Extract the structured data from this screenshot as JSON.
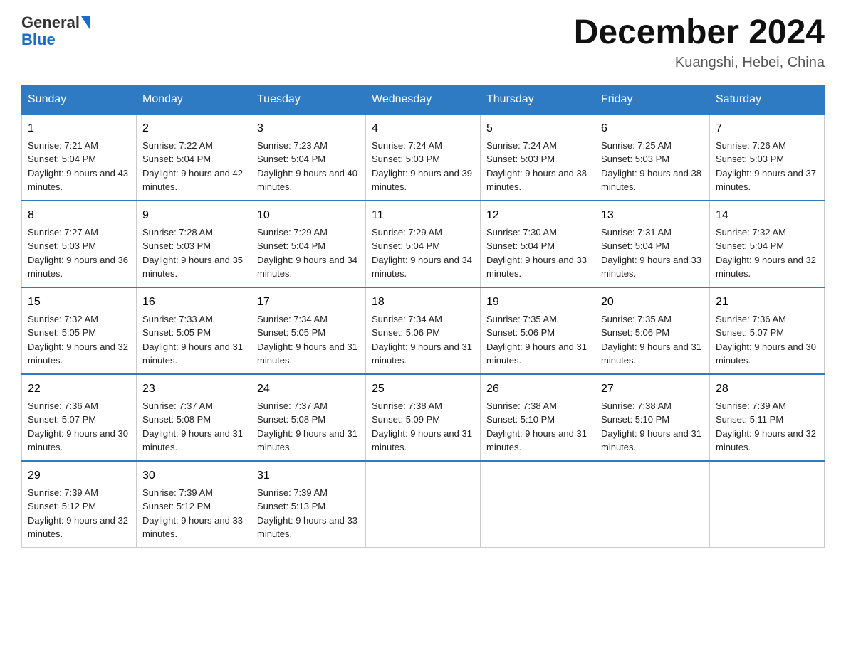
{
  "logo": {
    "text1": "General",
    "text2": "Blue"
  },
  "title": "December 2024",
  "location": "Kuangshi, Hebei, China",
  "days_of_week": [
    "Sunday",
    "Monday",
    "Tuesday",
    "Wednesday",
    "Thursday",
    "Friday",
    "Saturday"
  ],
  "weeks": [
    [
      {
        "day": "1",
        "sunrise": "7:21 AM",
        "sunset": "5:04 PM",
        "daylight": "9 hours and 43 minutes."
      },
      {
        "day": "2",
        "sunrise": "7:22 AM",
        "sunset": "5:04 PM",
        "daylight": "9 hours and 42 minutes."
      },
      {
        "day": "3",
        "sunrise": "7:23 AM",
        "sunset": "5:04 PM",
        "daylight": "9 hours and 40 minutes."
      },
      {
        "day": "4",
        "sunrise": "7:24 AM",
        "sunset": "5:03 PM",
        "daylight": "9 hours and 39 minutes."
      },
      {
        "day": "5",
        "sunrise": "7:24 AM",
        "sunset": "5:03 PM",
        "daylight": "9 hours and 38 minutes."
      },
      {
        "day": "6",
        "sunrise": "7:25 AM",
        "sunset": "5:03 PM",
        "daylight": "9 hours and 38 minutes."
      },
      {
        "day": "7",
        "sunrise": "7:26 AM",
        "sunset": "5:03 PM",
        "daylight": "9 hours and 37 minutes."
      }
    ],
    [
      {
        "day": "8",
        "sunrise": "7:27 AM",
        "sunset": "5:03 PM",
        "daylight": "9 hours and 36 minutes."
      },
      {
        "day": "9",
        "sunrise": "7:28 AM",
        "sunset": "5:03 PM",
        "daylight": "9 hours and 35 minutes."
      },
      {
        "day": "10",
        "sunrise": "7:29 AM",
        "sunset": "5:04 PM",
        "daylight": "9 hours and 34 minutes."
      },
      {
        "day": "11",
        "sunrise": "7:29 AM",
        "sunset": "5:04 PM",
        "daylight": "9 hours and 34 minutes."
      },
      {
        "day": "12",
        "sunrise": "7:30 AM",
        "sunset": "5:04 PM",
        "daylight": "9 hours and 33 minutes."
      },
      {
        "day": "13",
        "sunrise": "7:31 AM",
        "sunset": "5:04 PM",
        "daylight": "9 hours and 33 minutes."
      },
      {
        "day": "14",
        "sunrise": "7:32 AM",
        "sunset": "5:04 PM",
        "daylight": "9 hours and 32 minutes."
      }
    ],
    [
      {
        "day": "15",
        "sunrise": "7:32 AM",
        "sunset": "5:05 PM",
        "daylight": "9 hours and 32 minutes."
      },
      {
        "day": "16",
        "sunrise": "7:33 AM",
        "sunset": "5:05 PM",
        "daylight": "9 hours and 31 minutes."
      },
      {
        "day": "17",
        "sunrise": "7:34 AM",
        "sunset": "5:05 PM",
        "daylight": "9 hours and 31 minutes."
      },
      {
        "day": "18",
        "sunrise": "7:34 AM",
        "sunset": "5:06 PM",
        "daylight": "9 hours and 31 minutes."
      },
      {
        "day": "19",
        "sunrise": "7:35 AM",
        "sunset": "5:06 PM",
        "daylight": "9 hours and 31 minutes."
      },
      {
        "day": "20",
        "sunrise": "7:35 AM",
        "sunset": "5:06 PM",
        "daylight": "9 hours and 31 minutes."
      },
      {
        "day": "21",
        "sunrise": "7:36 AM",
        "sunset": "5:07 PM",
        "daylight": "9 hours and 30 minutes."
      }
    ],
    [
      {
        "day": "22",
        "sunrise": "7:36 AM",
        "sunset": "5:07 PM",
        "daylight": "9 hours and 30 minutes."
      },
      {
        "day": "23",
        "sunrise": "7:37 AM",
        "sunset": "5:08 PM",
        "daylight": "9 hours and 31 minutes."
      },
      {
        "day": "24",
        "sunrise": "7:37 AM",
        "sunset": "5:08 PM",
        "daylight": "9 hours and 31 minutes."
      },
      {
        "day": "25",
        "sunrise": "7:38 AM",
        "sunset": "5:09 PM",
        "daylight": "9 hours and 31 minutes."
      },
      {
        "day": "26",
        "sunrise": "7:38 AM",
        "sunset": "5:10 PM",
        "daylight": "9 hours and 31 minutes."
      },
      {
        "day": "27",
        "sunrise": "7:38 AM",
        "sunset": "5:10 PM",
        "daylight": "9 hours and 31 minutes."
      },
      {
        "day": "28",
        "sunrise": "7:39 AM",
        "sunset": "5:11 PM",
        "daylight": "9 hours and 32 minutes."
      }
    ],
    [
      {
        "day": "29",
        "sunrise": "7:39 AM",
        "sunset": "5:12 PM",
        "daylight": "9 hours and 32 minutes."
      },
      {
        "day": "30",
        "sunrise": "7:39 AM",
        "sunset": "5:12 PM",
        "daylight": "9 hours and 33 minutes."
      },
      {
        "day": "31",
        "sunrise": "7:39 AM",
        "sunset": "5:13 PM",
        "daylight": "9 hours and 33 minutes."
      },
      null,
      null,
      null,
      null
    ]
  ]
}
